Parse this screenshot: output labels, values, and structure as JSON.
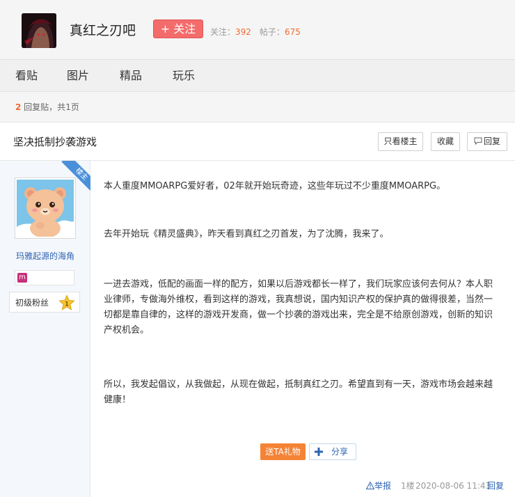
{
  "forum": {
    "name": "真红之刃吧",
    "follow_label": "+ 关注",
    "followers_label": "关注：",
    "followers": "392",
    "posts_label": "帖子：",
    "posts": "675"
  },
  "nav": {
    "items": [
      {
        "label": "看贴"
      },
      {
        "label": "图片"
      },
      {
        "label": "精品"
      },
      {
        "label": "玩乐"
      }
    ]
  },
  "pager": {
    "reply_count": "2",
    "reply_suffix": " 回复贴，共",
    "pages": "1",
    "pages_suffix": "页"
  },
  "thread": {
    "title": "坚决抵制抄袭游戏",
    "only_op_label": "只看楼主",
    "favorite_label": "收藏",
    "reply_label": "回复"
  },
  "author": {
    "ribbon": "楼主",
    "name": "玛雅起源的海角",
    "badge_letter": "m",
    "level_title": "初级粉丝",
    "level_num": "1"
  },
  "post": {
    "paragraphs": [
      "本人重度MMOARPG爱好者，02年就开始玩奇迹，这些年玩过不少重度MMOARPG。",
      "去年开始玩《精灵盛典》，昨天看到真红之刃首发，为了沈腾，我来了。",
      "一进去游戏，低配的画面一样的配方，如果以后游戏都长一样了，我们玩家应该何去何从？本人职业律师，专做海外维权，看到这样的游戏，我真想说，国内知识产权的保护真的做得很差，当然一切都是靠自律的，这样的游戏开发商，做一个抄袭的游戏出来，完全是不给原创游戏，创新的知识产权机会。",
      "所以，我发起倡议，从我做起，从现在做起，抵制真红之刃。希望直到有一天，游戏市场会越来越健康！"
    ],
    "gift_label": "送TA礼物",
    "share_label": "分享",
    "report_label": "举报",
    "floor": "1楼",
    "time": "2020-08-06 11:43",
    "reply_label": "回复"
  },
  "colors": {
    "accent_orange": "#f06a2e",
    "follow_red": "#f36b6b",
    "link_blue": "#2d64b3",
    "ribbon_blue": "#4a90d9"
  }
}
